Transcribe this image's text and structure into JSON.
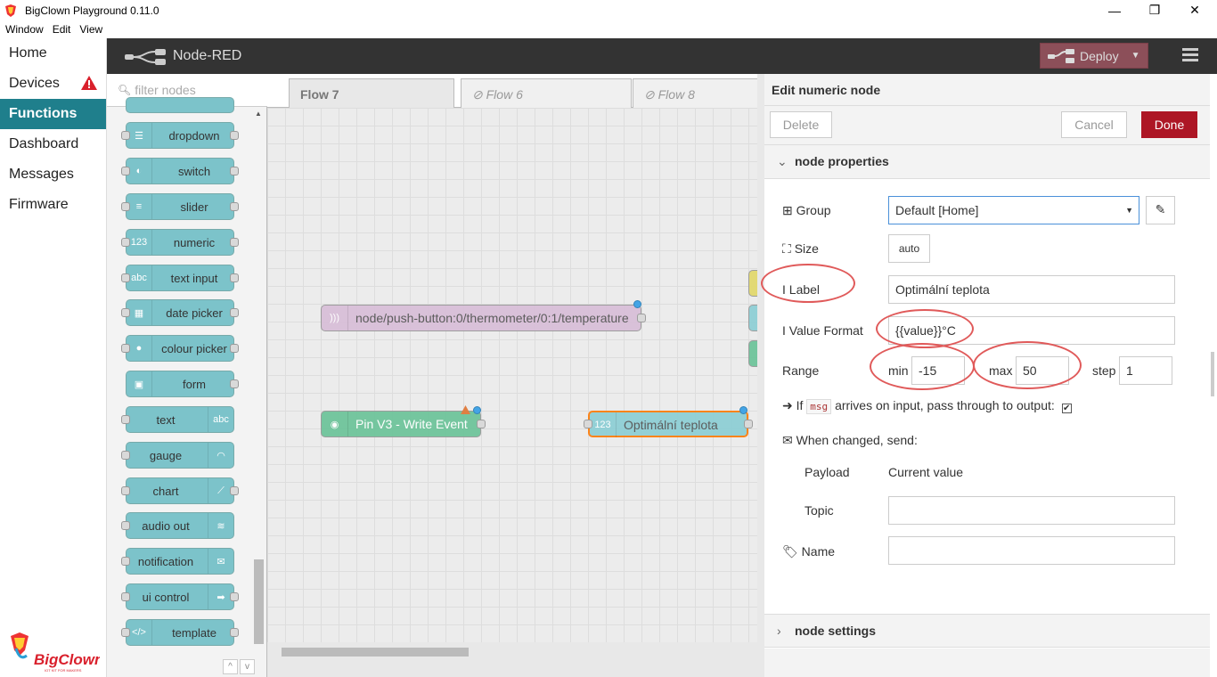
{
  "window": {
    "title": "BigClown Playground 0.11.0",
    "menu": [
      "Window",
      "Edit",
      "View"
    ],
    "controls": {
      "minimize": "—",
      "maximize": "❐",
      "close": "✕"
    }
  },
  "appnav": {
    "items": [
      {
        "label": "Home"
      },
      {
        "label": "Devices"
      },
      {
        "label": "Functions"
      },
      {
        "label": "Dashboard"
      },
      {
        "label": "Messages"
      },
      {
        "label": "Firmware"
      }
    ],
    "logo_text": "BigClown",
    "logo_subtext": "IOT KIT FOR MAKERS"
  },
  "header": {
    "title": "Node-RED",
    "deploy_label": "Deploy"
  },
  "palette": {
    "filter_placeholder": "filter nodes",
    "nodes": [
      {
        "label": "dropdown"
      },
      {
        "label": "switch"
      },
      {
        "label": "slider"
      },
      {
        "label": "numeric",
        "icon": "123"
      },
      {
        "label": "text input",
        "icon": "abc"
      },
      {
        "label": "date picker"
      },
      {
        "label": "colour picker"
      },
      {
        "label": "form"
      },
      {
        "label": "text",
        "icon": "abc"
      },
      {
        "label": "gauge"
      },
      {
        "label": "chart"
      },
      {
        "label": "audio out"
      },
      {
        "label": "notification"
      },
      {
        "label": "ui control"
      },
      {
        "label": "template",
        "icon": "</>"
      }
    ],
    "footer": [
      "^",
      "v"
    ]
  },
  "workspace": {
    "tabs": [
      {
        "label": "Flow 7"
      },
      {
        "label": "Flow 6",
        "icon": "⊘"
      },
      {
        "label": "Flow 8",
        "icon": "⊘"
      }
    ],
    "flow_nodes": [
      {
        "label": "node/push-button:0/thermometer/0:1/temperature"
      },
      {
        "label": "Pin V3 - Write Event"
      },
      {
        "label": "Optimální teplota",
        "icon": "123"
      }
    ]
  },
  "editor": {
    "title": "Edit numeric node",
    "delete_label": "Delete",
    "cancel_label": "Cancel",
    "done_label": "Done",
    "section_properties": "node properties",
    "section_settings": "node settings",
    "group_label": "Group",
    "group_value": "Default [Home]",
    "size_label": "Size",
    "size_value": "auto",
    "label_label": "Label",
    "label_value": "Optimální teplota",
    "format_label": "Value Format",
    "format_value": "{{value}}°C",
    "range_label": "Range",
    "min_label": "min",
    "min_value": "-15",
    "max_label": "max",
    "max_value": "50",
    "step_label": "step",
    "step_value": "1",
    "passthrough_prefix": "If",
    "passthrough_code": "msg",
    "passthrough_suffix": "arrives on input, pass through to output:",
    "passthrough_checked": "✔",
    "when_changed": "When changed, send:",
    "payload_label": "Payload",
    "payload_value": "Current value",
    "topic_label": "Topic",
    "topic_value": "",
    "name_label": "Name",
    "name_value": ""
  }
}
